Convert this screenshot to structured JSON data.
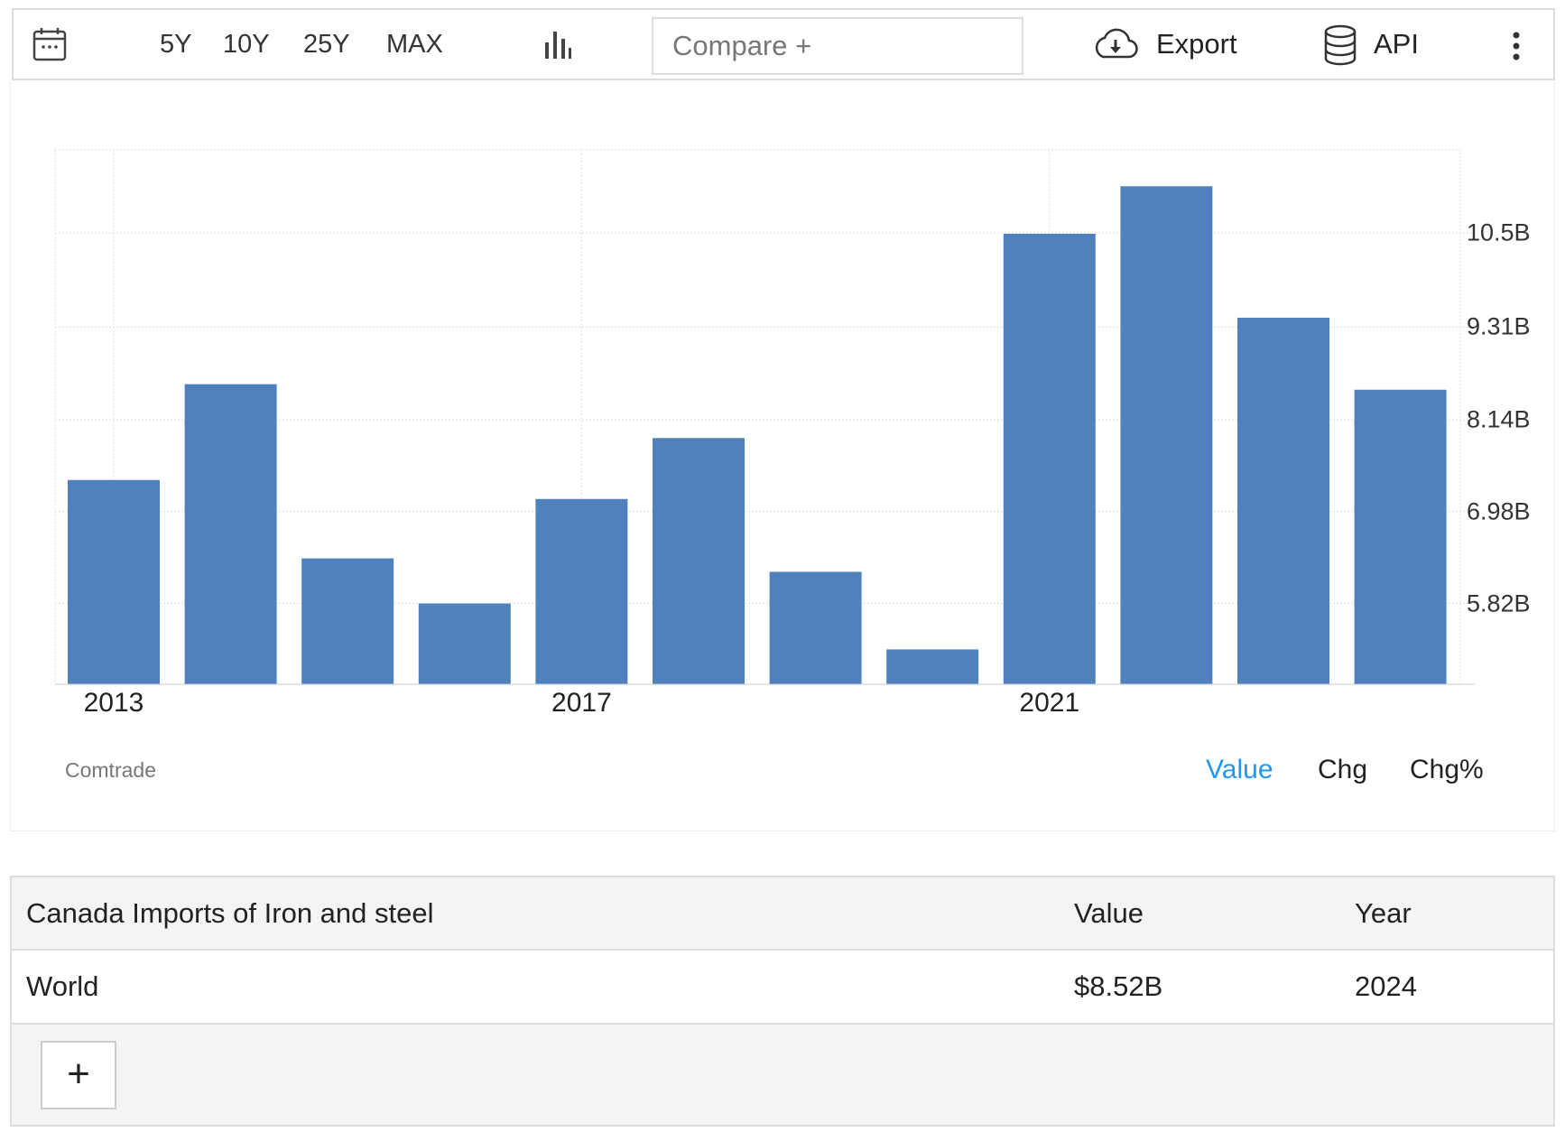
{
  "toolbar": {
    "ranges": [
      "5Y",
      "10Y",
      "25Y",
      "MAX"
    ],
    "compare_placeholder": "Compare +",
    "export_label": "Export",
    "api_label": "API"
  },
  "chart_data": {
    "type": "bar",
    "title": "",
    "xlabel": "",
    "ylabel": "",
    "categories": [
      "2013",
      "2014",
      "2015",
      "2016",
      "2017",
      "2018",
      "2019",
      "2020",
      "2021",
      "2022",
      "2023",
      "2024"
    ],
    "values": [
      7.38,
      8.59,
      6.39,
      5.82,
      7.14,
      7.91,
      6.22,
      5.24,
      10.49,
      11.09,
      9.43,
      8.52
    ],
    "unit": "B USD",
    "ylim": [
      4.8,
      11.55
    ],
    "yticks": [
      5.82,
      6.98,
      8.14,
      9.31,
      10.5
    ],
    "ytick_labels": [
      "5.82B",
      "6.98B",
      "8.14B",
      "9.31B",
      "10.5B"
    ],
    "xtick_labels": [
      "2013",
      "2017",
      "2021"
    ],
    "color": "#4f81bd",
    "grid": true
  },
  "source": "Comtrade",
  "modes": {
    "value": "Value",
    "chg": "Chg",
    "chgpct": "Chg%",
    "active_color": "#2196f3"
  },
  "table": {
    "headers": [
      "Canada Imports of Iron and steel",
      "Value",
      "Year"
    ],
    "rows": [
      [
        "World",
        "$8.52B",
        "2024"
      ]
    ],
    "add_label": "+"
  }
}
